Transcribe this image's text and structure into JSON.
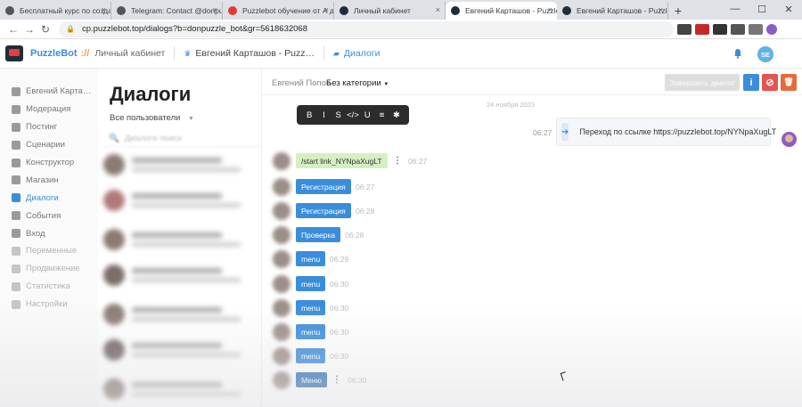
{
  "browser": {
    "tabs": [
      {
        "title": "Бесплатный курс по создани…",
        "favicon_color": "#555555",
        "active": false
      },
      {
        "title": "Telegram: Contact @donpuzzlc…",
        "favicon_color": "#555555",
        "active": false
      },
      {
        "title": "Puzzlebot обучение от А до Я…",
        "favicon_color": "#e53935",
        "active": false
      },
      {
        "title": "Личный кабинет",
        "favicon_color": "#1f2d3a",
        "active": false
      },
      {
        "title": "Евгений Карташов - Puzzlebot",
        "favicon_color": "#1f2d3a",
        "active": true
      },
      {
        "title": "Евгений Карташов - Puzzlebot",
        "favicon_color": "#1f2d3a",
        "active": false
      }
    ],
    "new_tab": "+",
    "close_glyph": "×",
    "url": "cp.puzzlebot.top/dialogs?b=donpuzzle_bot&gr=5618632068"
  },
  "header": {
    "brand": "PuzzleBot",
    "brand_sep": "://",
    "breadcrumb_cabinet": "Личный кабинет",
    "breadcrumb_bot": "Евгений Карташов - Puzz…",
    "breadcrumb_section": "Диалоги",
    "avatar_initials": "SE"
  },
  "sidebar": {
    "items": [
      {
        "label": "Евгений Карта…",
        "icon": "crown-icon",
        "active": false
      },
      {
        "label": "Модерация",
        "icon": "users-icon",
        "active": false
      },
      {
        "label": "Постинг",
        "icon": "megaphone-icon",
        "active": false
      },
      {
        "label": "Сценарии",
        "icon": "flow-icon",
        "active": false
      },
      {
        "label": "Конструктор",
        "icon": "grid-icon",
        "active": false
      },
      {
        "label": "Магазин",
        "icon": "cart-icon",
        "active": false
      },
      {
        "label": "Диалоги",
        "icon": "chat-icon",
        "active": true
      },
      {
        "label": "События",
        "icon": "star-icon",
        "active": false
      },
      {
        "label": "Вход",
        "icon": "login-icon",
        "active": false
      },
      {
        "label": "Переменные",
        "icon": "variables-icon",
        "active": false
      },
      {
        "label": "Продвижение",
        "icon": "promo-icon",
        "active": false
      },
      {
        "label": "Статистика",
        "icon": "chart-icon",
        "active": false
      },
      {
        "label": "Настройки",
        "icon": "gear-icon",
        "active": false
      }
    ]
  },
  "dialogs_list": {
    "title": "Диалоги",
    "filter": "Все пользователи",
    "search_placeholder": "Диалоги поиск"
  },
  "chat": {
    "user": "Евгений Попов",
    "category": "Без категории",
    "finish_button": "Завершить диалог",
    "info_glyph": "i",
    "block_glyph": "⊘",
    "delete_glyph": "🗑",
    "format_toolbar": [
      "B",
      "I",
      "S",
      "</>",
      "U",
      "≡",
      "✱"
    ],
    "date": "24 ноября 2023",
    "outgoing": {
      "time": "06:27",
      "text": "Переход по ссылке https://puzzlebot.top/NYNpaXugLT"
    },
    "incoming": [
      {
        "text": "/start link_NYNpaXugLT",
        "time": "06:27",
        "style": "green",
        "dots": true
      },
      {
        "text": "Регистрация",
        "time": "06:27",
        "style": "blue",
        "dots": false
      },
      {
        "text": "Регистрация",
        "time": "06:28",
        "style": "blue",
        "dots": false
      },
      {
        "text": "Проверка",
        "time": "06:28",
        "style": "blue",
        "dots": false
      },
      {
        "text": "menu",
        "time": "06:29",
        "style": "blue",
        "dots": false
      },
      {
        "text": "menu",
        "time": "06:30",
        "style": "blue",
        "dots": false
      },
      {
        "text": "menu",
        "time": "06:30",
        "style": "blue",
        "dots": false
      },
      {
        "text": "menu",
        "time": "06:30",
        "style": "blue",
        "dots": false
      },
      {
        "text": "menu",
        "time": "06:30",
        "style": "blue",
        "dots": false
      },
      {
        "text": "Меню",
        "time": "06:30",
        "style": "dark",
        "dots": true
      }
    ]
  },
  "colors": {
    "accent": "#3a8ddb",
    "info": "#3a8ddb",
    "block": "#e55353",
    "delete": "#e56b3b"
  }
}
